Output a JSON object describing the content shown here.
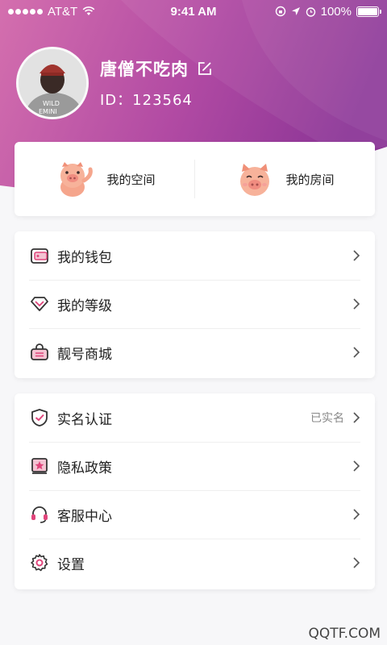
{
  "status_bar": {
    "carrier": "AT&T",
    "time": "9:41 AM",
    "battery": "100%"
  },
  "profile": {
    "name": "唐僧不吃肉",
    "id_text": "ID：123564",
    "avatar_text": "WILD\nFEMINI"
  },
  "quick_actions": [
    {
      "label": "我的空间",
      "icon": "pig-waving-icon"
    },
    {
      "label": "我的房间",
      "icon": "pig-face-icon"
    }
  ],
  "menu_group_1": [
    {
      "label": "我的钱包",
      "icon": "wallet-icon"
    },
    {
      "label": "我的等级",
      "icon": "diamond-icon"
    },
    {
      "label": "靓号商城",
      "icon": "shopping-basket-icon"
    }
  ],
  "menu_group_2": [
    {
      "label": "实名认证",
      "icon": "shield-check-icon",
      "status": "已实名"
    },
    {
      "label": "隐私政策",
      "icon": "star-book-icon"
    },
    {
      "label": "客服中心",
      "icon": "headset-icon"
    },
    {
      "label": "设置",
      "icon": "gear-icon"
    }
  ],
  "watermark": "QQTF.COM",
  "colors": {
    "header_start": "#d06aa9",
    "header_end": "#8e3a9a",
    "accent": "#e0457b"
  }
}
